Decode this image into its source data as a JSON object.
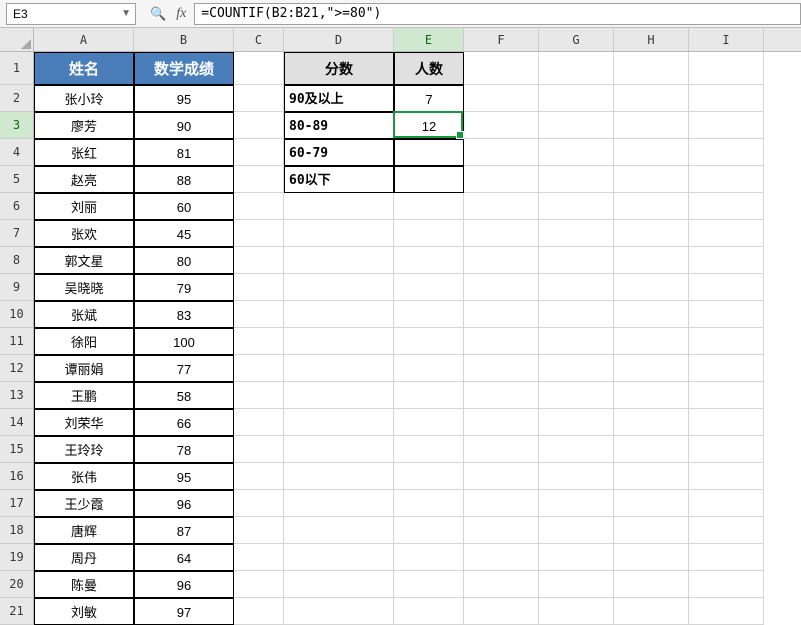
{
  "namebox": "E3",
  "formula": "=COUNTIF(B2:B21,\">=80\")",
  "columns": [
    "A",
    "B",
    "C",
    "D",
    "E",
    "F",
    "G",
    "H",
    "I"
  ],
  "activeCol": "E",
  "activeRow": 3,
  "headers": {
    "name": "姓名",
    "score": "数学成绩"
  },
  "students": [
    {
      "name": "张小玲",
      "score": 95
    },
    {
      "name": "廖芳",
      "score": 90
    },
    {
      "name": "张红",
      "score": 81
    },
    {
      "name": "赵亮",
      "score": 88
    },
    {
      "name": "刘丽",
      "score": 60
    },
    {
      "name": "张欢",
      "score": 45
    },
    {
      "name": "郭文星",
      "score": 80
    },
    {
      "name": "吴晓晓",
      "score": 79
    },
    {
      "name": "张斌",
      "score": 83
    },
    {
      "name": "徐阳",
      "score": 100
    },
    {
      "name": "谭丽娟",
      "score": 77
    },
    {
      "name": "王鹏",
      "score": 58
    },
    {
      "name": "刘荣华",
      "score": 66
    },
    {
      "name": "王玲玲",
      "score": 78
    },
    {
      "name": "张伟",
      "score": 95
    },
    {
      "name": "王少霞",
      "score": 96
    },
    {
      "name": "唐辉",
      "score": 87
    },
    {
      "name": "周丹",
      "score": 64
    },
    {
      "name": "陈曼",
      "score": 96
    },
    {
      "name": "刘敏",
      "score": 97
    }
  ],
  "summary": {
    "header_range": "分数",
    "header_count": "人数",
    "rows": [
      {
        "label": "90及以上",
        "count": 7
      },
      {
        "label": "80-89",
        "count": 12
      },
      {
        "label": "60-79",
        "count": ""
      },
      {
        "label": "60以下",
        "count": ""
      }
    ]
  }
}
